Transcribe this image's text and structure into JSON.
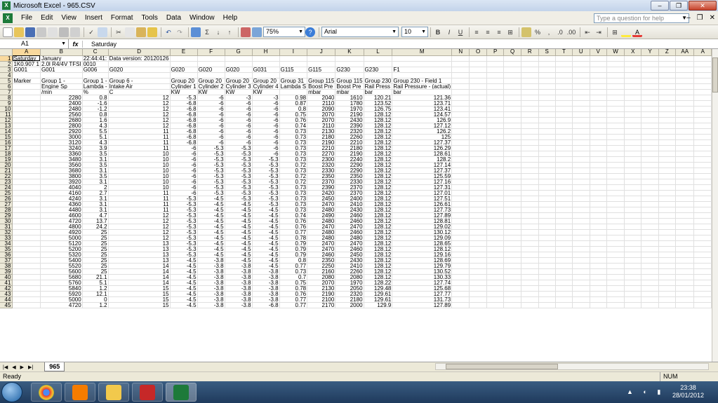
{
  "window": {
    "title": "Microsoft Excel - 965.CSV"
  },
  "menu": [
    "File",
    "Edit",
    "View",
    "Insert",
    "Format",
    "Tools",
    "Data",
    "Window",
    "Help"
  ],
  "help_placeholder": "Type a question for help",
  "toolbar": {
    "zoom": "75%",
    "font": "Arial",
    "size": "10",
    "bold": "B",
    "italic": "I",
    "underline": "U",
    "percent": "%",
    "sigma": "Σ"
  },
  "formula": {
    "namebox": "A1",
    "fx": "fx",
    "value": "Saturday"
  },
  "columns": [
    "A",
    "B",
    "C",
    "D",
    "E",
    "F",
    "G",
    "H",
    "I",
    "J",
    "K",
    "L",
    "M",
    "N",
    "O",
    "P",
    "Q",
    "R",
    "S",
    "T",
    "U",
    "V",
    "W",
    "X",
    "Y",
    "Z",
    "AA",
    "A"
  ],
  "rows": [
    [
      "Saturday",
      "January",
      "22:44:41:",
      "Data version: 20120126",
      "",
      "",
      "",
      "",
      "",
      "",
      "",
      "",
      ""
    ],
    [
      "1K0.907 1",
      "2.0l R4/4V TFSI",
      "0010",
      "",
      "",
      "",
      "",
      "",
      "",
      "",
      "",
      "",
      ""
    ],
    [
      "G001",
      "G001",
      "G006",
      "G020",
      "G020",
      "G020",
      "G020",
      "G031",
      "G115",
      "G115",
      "G230",
      "G230",
      "F1"
    ],
    [
      "",
      "",
      "",
      "",
      "",
      "",
      "",
      "",
      "",
      "",
      "",
      "",
      ""
    ],
    [
      "Marker",
      "Group 1 -",
      "Group 1 -",
      "Group 6 -",
      "Group 20",
      "Group 20",
      "Group 20",
      "Group 20",
      "Group 31",
      "Group 115",
      "Group 115",
      "Group 230",
      "Group 230 - Field 1"
    ],
    [
      "",
      "Engine Sp",
      "Lambda -",
      "Intake Air",
      "Cylinder 1",
      "Cylinder 2",
      "Cylinder 3",
      "Cylinder 4",
      "Lambda S",
      "Boost Pre",
      "Boost Pre",
      "Rail Press",
      "Rail Pressure - (actual)"
    ],
    [
      "",
      "/min",
      "%",
      "C",
      "KW",
      "KW",
      "KW",
      "KW",
      "",
      "mbar",
      "mbar",
      "bar",
      "bar"
    ]
  ],
  "data": [
    [
      2280,
      0.8,
      12,
      -5.3,
      -6,
      -3,
      -3,
      0.98,
      2040,
      1610,
      120.21,
      121.36
    ],
    [
      2400,
      -1.6,
      12,
      -6.8,
      -6,
      -6,
      -6,
      0.87,
      2110,
      1780,
      123.52,
      123.71
    ],
    [
      2480,
      -1.2,
      12,
      -6.8,
      -6,
      -6,
      -6,
      0.8,
      2090,
      1970,
      126.75,
      123.41
    ],
    [
      2560,
      0.8,
      12,
      -6.8,
      -6,
      -6,
      -6,
      0.75,
      2070,
      2190,
      128.12,
      124.57
    ],
    [
      2680,
      1.6,
      12,
      -6.8,
      -6,
      -6,
      -6,
      0.76,
      2070,
      2430,
      128.12,
      126.9
    ],
    [
      2800,
      4.3,
      12,
      -6.8,
      -6,
      -6,
      -6,
      0.74,
      2110,
      2390,
      128.12,
      127.12
    ],
    [
      2920,
      5.5,
      11,
      -6.8,
      -6,
      -6,
      -6,
      0.73,
      2130,
      2320,
      128.12,
      126.2
    ],
    [
      3000,
      5.1,
      11,
      -6.8,
      -6,
      -6,
      -6,
      0.73,
      2180,
      2260,
      128.12,
      125
    ],
    [
      3120,
      4.3,
      11,
      -6.8,
      -6,
      -6,
      -6,
      0.73,
      2190,
      2210,
      128.12,
      127.37
    ],
    [
      3240,
      3.9,
      11,
      -6,
      -5.3,
      -5.3,
      -6,
      0.73,
      2210,
      2180,
      128.12,
      126.29
    ],
    [
      3360,
      3.5,
      10,
      -6,
      -5.3,
      -5.3,
      -6,
      0.73,
      2270,
      2190,
      128.12,
      128.61
    ],
    [
      3480,
      3.1,
      10,
      -6,
      -5.3,
      -5.3,
      -5.3,
      0.73,
      2300,
      2240,
      128.12,
      128.2
    ],
    [
      3560,
      3.5,
      10,
      -6,
      -5.3,
      -5.3,
      -5.3,
      0.72,
      2320,
      2290,
      128.12,
      127.14
    ],
    [
      3680,
      3.1,
      10,
      -6,
      -5.3,
      -5.3,
      -5.3,
      0.73,
      2330,
      2290,
      128.12,
      127.37
    ],
    [
      3800,
      3.5,
      10,
      -6,
      -5.3,
      -5.3,
      -5.3,
      0.72,
      2350,
      2350,
      128.12,
      125.59
    ],
    [
      3920,
      3.1,
      10,
      -6,
      -5.3,
      -5.3,
      -5.3,
      0.72,
      2370,
      2330,
      128.12,
      127.16
    ],
    [
      4040,
      2,
      10,
      -6,
      -5.3,
      -5.3,
      -5.3,
      0.73,
      2390,
      2370,
      128.12,
      127.31
    ],
    [
      4160,
      2.7,
      11,
      -6,
      -5.3,
      -5.3,
      -5.3,
      0.73,
      2420,
      2370,
      128.12,
      127.01
    ],
    [
      4240,
      3.1,
      11,
      -5.3,
      -4.5,
      -5.3,
      -5.3,
      0.73,
      2450,
      2400,
      128.12,
      127.51
    ],
    [
      4360,
      3.1,
      11,
      -5.3,
      -4.5,
      -4.5,
      -5.3,
      0.73,
      2470,
      2410,
      128.12,
      126.61
    ],
    [
      4480,
      3.1,
      11,
      -5.3,
      -4.5,
      -4.5,
      -4.5,
      0.73,
      2480,
      2430,
      128.12,
      127.73
    ],
    [
      4600,
      4.7,
      12,
      -5.3,
      -4.5,
      -4.5,
      -4.5,
      0.74,
      2490,
      2460,
      128.12,
      127.89
    ],
    [
      4720,
      13.7,
      12,
      -5.3,
      -4.5,
      -4.5,
      -4.5,
      0.76,
      2480,
      2460,
      128.12,
      128.81
    ],
    [
      4800,
      24.2,
      12,
      -5.3,
      -4.5,
      -4.5,
      -4.5,
      0.76,
      2470,
      2470,
      128.12,
      129.02
    ],
    [
      4920,
      25,
      12,
      -5.3,
      -4.5,
      -4.5,
      -4.5,
      0.77,
      2480,
      2460,
      128.12,
      130.12
    ],
    [
      5000,
      25,
      12,
      -5.3,
      -4.5,
      -4.5,
      -4.5,
      0.78,
      2480,
      2480,
      128.12,
      129.09
    ],
    [
      5120,
      25,
      13,
      -5.3,
      -4.5,
      -4.5,
      -4.5,
      0.79,
      2470,
      2470,
      128.12,
      128.65
    ],
    [
      5200,
      25,
      13,
      -5.3,
      -4.5,
      -4.5,
      -4.5,
      0.79,
      2470,
      2460,
      128.12,
      128.12
    ],
    [
      5320,
      25,
      13,
      -5.3,
      -4.5,
      -4.5,
      -4.5,
      0.79,
      2460,
      2450,
      128.12,
      129.16
    ],
    [
      5400,
      25,
      13,
      -4.5,
      -3.8,
      -4.5,
      -4.5,
      0.8,
      2350,
      2430,
      128.12,
      128.69
    ],
    [
      5520,
      25,
      14,
      -4.5,
      -3.8,
      -3.8,
      -4.5,
      0.77,
      2250,
      2410,
      128.12,
      129.79
    ],
    [
      5600,
      25,
      14,
      -4.5,
      -3.8,
      -3.8,
      -3.8,
      0.73,
      2160,
      2260,
      128.12,
      130.52
    ],
    [
      5680,
      21.1,
      14,
      -4.5,
      -3.8,
      -3.8,
      -3.8,
      0.7,
      2080,
      2080,
      128.12,
      130.33
    ],
    [
      5760,
      5.1,
      14,
      -4.5,
      -3.8,
      -3.8,
      -3.8,
      0.75,
      2070,
      1970,
      128.22,
      127.74
    ],
    [
      5840,
      1.2,
      15,
      -4.5,
      -3.8,
      -3.8,
      -3.8,
      0.78,
      2130,
      2050,
      129.48,
      125.68
    ],
    [
      5920,
      12.1,
      15,
      -4.5,
      -3.8,
      -3.8,
      -3.8,
      0.76,
      2190,
      2320,
      129.61,
      127.77
    ],
    [
      5000,
      0,
      15,
      -4.5,
      -3.8,
      -3.8,
      -3.8,
      0.77,
      2100,
      2180,
      129.61,
      131.73
    ],
    [
      4720,
      1.2,
      15,
      -4.5,
      -3.8,
      -3.8,
      -6.8,
      0.77,
      2170,
      2000,
      129.9,
      127.89
    ]
  ],
  "sheet_tab": "965",
  "status": {
    "ready": "Ready",
    "num": "NUM"
  },
  "clock": {
    "time": "23:38",
    "date": "28/01/2012"
  },
  "colors": {
    "excel_green": "#1d7a3a",
    "taskbar": "#1f3a5c",
    "selected_header": "#f9d99d"
  }
}
